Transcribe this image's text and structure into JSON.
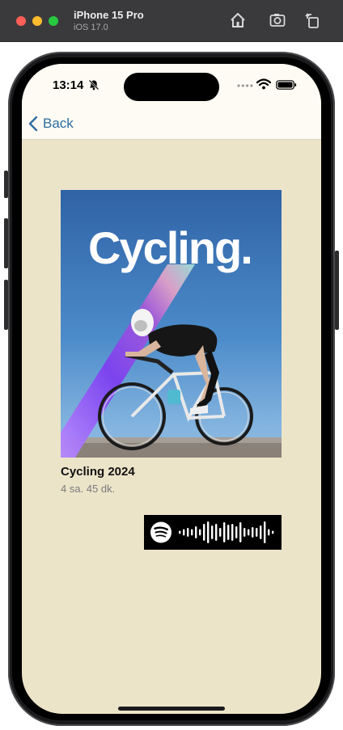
{
  "window": {
    "title": "iPhone 15 Pro",
    "subtitle": "iOS 17.0"
  },
  "status_bar": {
    "time": "13:14",
    "silent_icon": "bell-slash-icon",
    "wifi_icon": "wifi-icon",
    "battery_icon": "battery-icon"
  },
  "nav": {
    "back_label": "Back",
    "back_icon": "chevron-left-icon"
  },
  "album": {
    "cover_text": "Cycling.",
    "title": "Cycling 2024",
    "duration": "4 sa. 45 dk."
  },
  "spotify_code": {
    "logo_icon": "spotify-logo-icon"
  },
  "colors": {
    "background": "#ece4c9",
    "nav_background": "#fdfbf3",
    "link": "#2d6da3",
    "cover_sky": "#3f77b6"
  }
}
